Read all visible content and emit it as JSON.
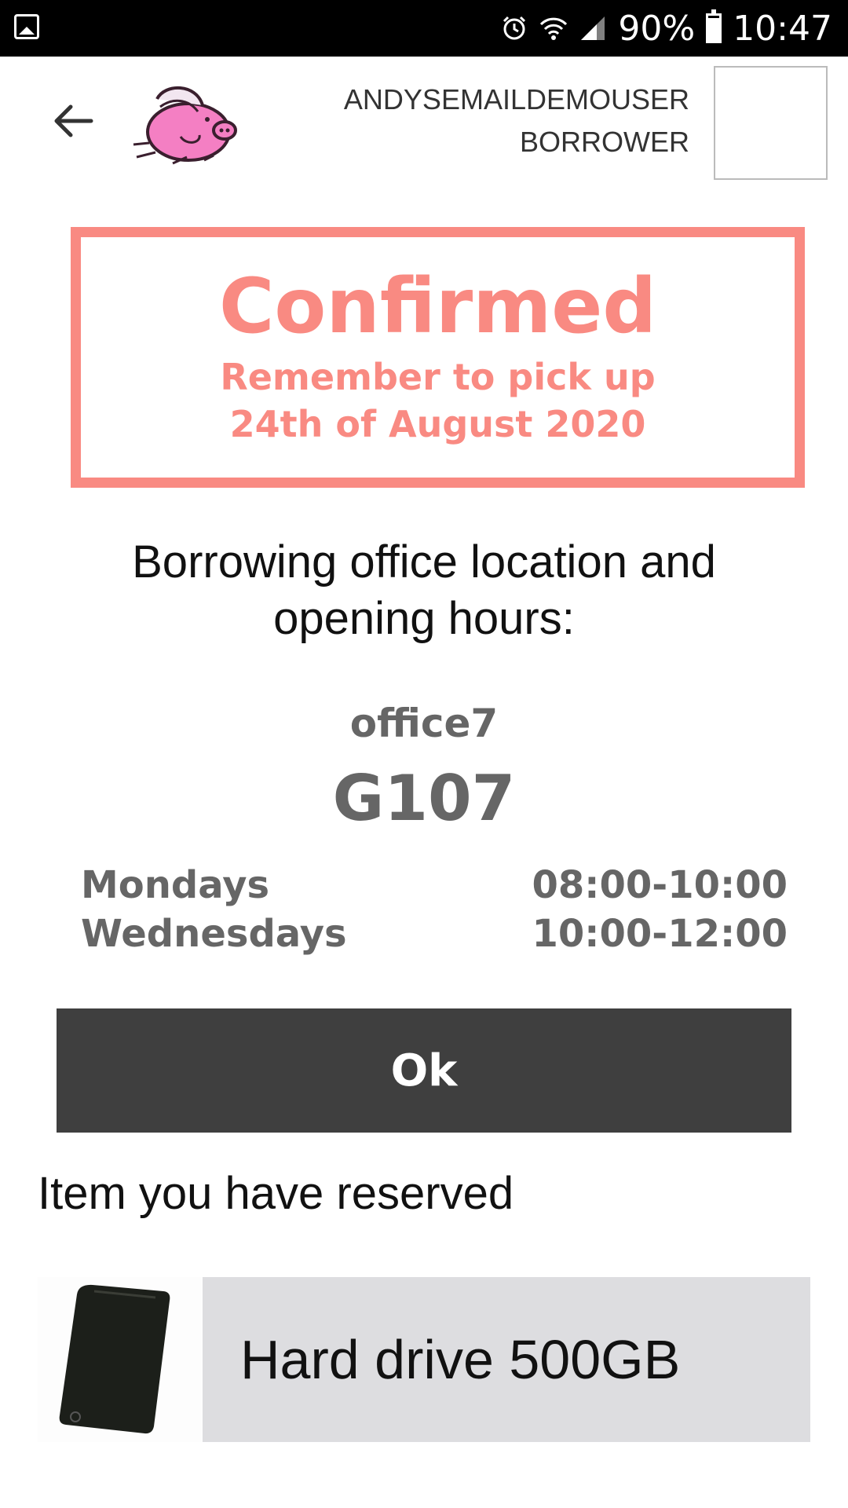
{
  "status_bar": {
    "battery": "90%",
    "time": "10:47",
    "battery_level": 0.9
  },
  "header": {
    "username": "ANDYSEMAILDEMOUSER",
    "role": "BORROWER"
  },
  "confirmation": {
    "title": "Confirmed",
    "subtitle": "Remember to pick up",
    "date": "24th of August 2020",
    "color": "#f98a82"
  },
  "location": {
    "heading_line1": "Borrowing office location and",
    "heading_line2": "opening hours:",
    "office": "office7",
    "room": "G107",
    "hours": [
      {
        "day": "Mondays",
        "time": "08:00-10:00"
      },
      {
        "day": "Wednesdays",
        "time": "10:00-12:00"
      }
    ]
  },
  "actions": {
    "ok_label": "Ok"
  },
  "reserved": {
    "heading": "Item you have reserved",
    "item_name": "Hard drive 500GB"
  }
}
